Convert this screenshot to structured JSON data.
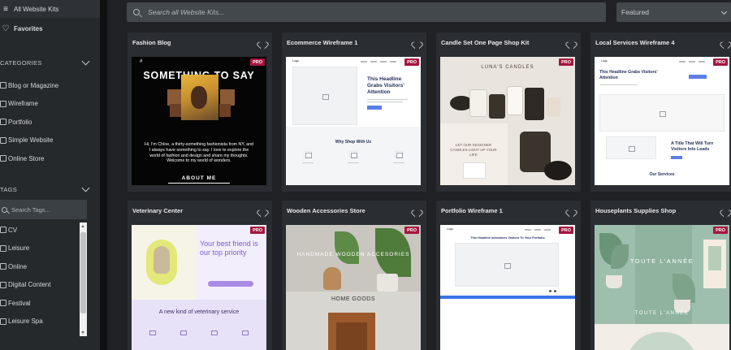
{
  "sidebar": {
    "nav": [
      {
        "label": "All Website Kits",
        "icon": "menu-icon"
      },
      {
        "label": "Favorites",
        "icon": "heart-icon"
      }
    ],
    "categories_title": "CATEGORIES",
    "categories": [
      "Blog or Magazine",
      "Wireframe",
      "Portfolio",
      "Simple Website",
      "Online Store"
    ],
    "tags_title": "TAGS",
    "tags_search_placeholder": "Search Tags...",
    "tags": [
      "CV",
      "Leisure",
      "Online",
      "Digital Content",
      "Festival",
      "Leisure Spa"
    ]
  },
  "main": {
    "search_placeholder": "Search all Website Kits...",
    "sort_selected": "Featured",
    "badge": "PRO",
    "cards": [
      {
        "title": "Fashion Blog"
      },
      {
        "title": "Ecommerce Wireframe 1"
      },
      {
        "title": "Candle Set One Page Shop Kit"
      },
      {
        "title": "Local Services Wireframe 4"
      },
      {
        "title": "Veterinary Center"
      },
      {
        "title": "Wooden Accessories Store"
      },
      {
        "title": "Portfolio Wireframe 1"
      },
      {
        "title": "Houseplants Supplies Shop"
      }
    ]
  },
  "previews": {
    "fashion": {
      "hash": "#",
      "headline": "SOMETHING TO SAY",
      "bio": "Hi, I'm Chloe, a thirty-something fashionista from NY, and I always have something to say. I love to explore the world of fashion and design and share my thoughts. Welcome to my world of wonders.",
      "cta": "ABOUT ME"
    },
    "ecom": {
      "logo": "Logo",
      "headline": "This Headline Grabs Visitors' Attention",
      "section": "Why Shop With Us"
    },
    "candle": {
      "brand": "LUNA'S CANDLES",
      "tagline": "LET OUR DESIGNER CANDLES LIGHT UP YOUR LIFE"
    },
    "local": {
      "logo": "Logo",
      "headline": "This Headline Grabs Visitors' Attention",
      "subheading": "A Title That Will Turn Visitors Into Leads",
      "section": "Our Services"
    },
    "vet": {
      "headline": "Your best friend is our top priority",
      "sub": "A new kind of veterinary service"
    },
    "wood": {
      "headline": "HANDMADE WOODEN ACCESORIES",
      "sub": "HOME GOODS"
    },
    "portfolio": {
      "logo": "Logo",
      "headline": "This Headline Introduces Visitors To Your Portfolio"
    },
    "plants": {
      "headline": "TOUTE L'ANNÉE",
      "footer": "TOUTE L'ANNÉE"
    }
  }
}
